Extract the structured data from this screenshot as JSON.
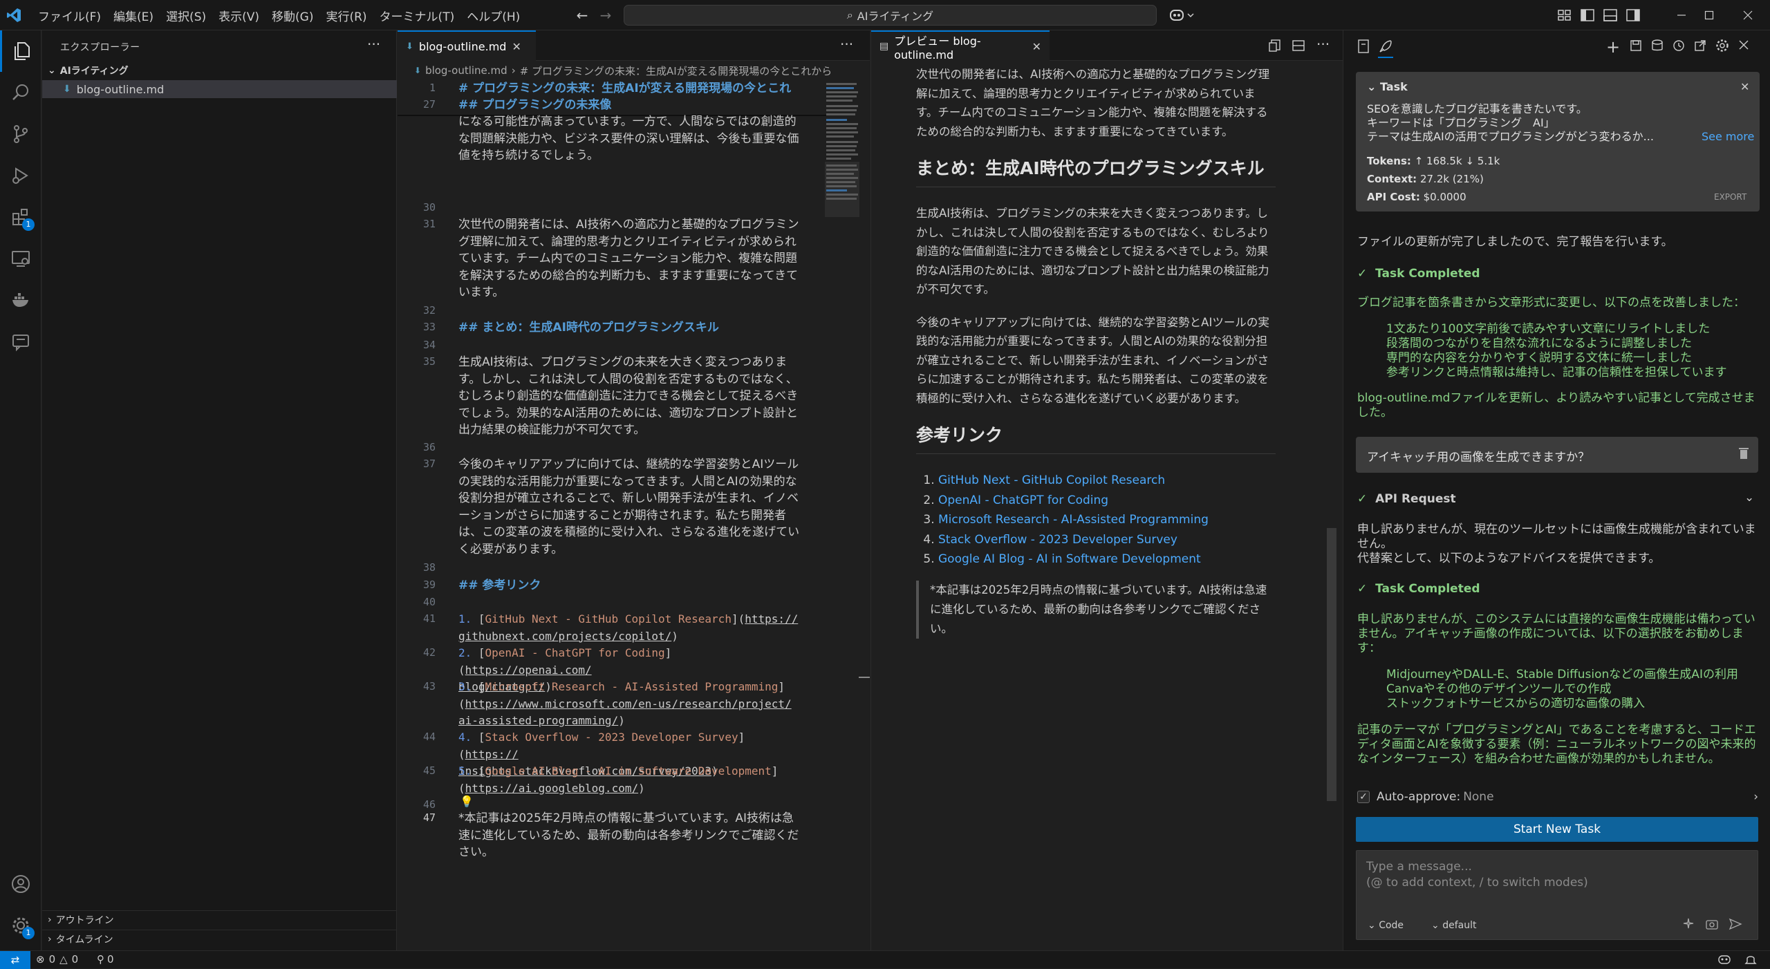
{
  "titlebar": {
    "menus": [
      "ファイル(F)",
      "編集(E)",
      "選択(S)",
      "表示(V)",
      "移動(G)",
      "実行(R)",
      "ターミナル(T)",
      "ヘルプ(H)"
    ],
    "search_text": "AIライティング"
  },
  "activity": {
    "extensions_badge": "1",
    "settings_badge": "1"
  },
  "sidebar": {
    "title": "エクスプローラー",
    "folder": "AIライティング",
    "file": "blog-outline.md",
    "outline": "アウトライン",
    "timeline": "タイムライン"
  },
  "editor": {
    "tab": "blog-outline.md",
    "breadcrumb_file": "blog-outline.md",
    "breadcrumb_symbol": "# プログラミングの未来：生成AIが変える開発現場の今とこれから",
    "sticky": [
      {
        "ln": "1",
        "text": "# プログラミングの未来：生成AIが変える開発現場の今とこれ"
      },
      {
        "ln": "27",
        "text": "## プログラミングの未来像"
      }
    ],
    "l29": "になる可能性が高まっています。一方で、人間ならではの創造的な問題解決能力や、ビジネス要件の深い理解は、今後も重要な価値を持ち続けるでしょう。",
    "l31": "次世代の開発者には、AI技術への適応力と基礎的なプログラミング理解に加えて、論理的思考力とクリエイティビティが求められています。チーム内でのコミュニケーション能力や、複雑な問題を解決するための総合的な判断力も、ますます重要になってきています。",
    "l33": "## まとめ：生成AI時代のプログラミングスキル",
    "l35": "生成AI技術は、プログラミングの未来を大きく変えつつあります。しかし、これは決して人間の役割を否定するものではなく、むしろより創造的な価値創造に注力できる機会として捉えるべきでしょう。効果的なAI活用のためには、適切なプロンプト設計と出力結果の検証能力が不可欠です。",
    "l37": "今後のキャリアアップに向けては、継続的な学習姿勢とAIツールの実践的な活用能力が重要になってきます。人間とAIの効果的な役割分担が確立されることで、新しい開発手法が生まれ、イノベーションがさらに加速することが期待されます。私たち開発者は、この変革の波を積極的に受け入れ、さらなる進化を遂げていく必要があります。",
    "l39": "## 参考リンク",
    "links": [
      {
        "ln": "41",
        "n": "1.",
        "text": "GitHub Next - GitHub Copilot Research",
        "url1": "https://",
        "url2": "githubnext.com/projects/copilot/"
      },
      {
        "ln": "42",
        "n": "2.",
        "text": "OpenAI - ChatGPT for Coding",
        "url1": "https://openai.com/",
        "url2": "blog/chatgpt/"
      },
      {
        "ln": "43",
        "n": "3.",
        "text": "Microsoft Research - AI-Assisted Programming",
        "url1": "https://www.microsoft.com/en-us/research/project/",
        "url2": "ai-assisted-programming/"
      },
      {
        "ln": "44",
        "n": "4.",
        "text": "Stack Overflow - 2023 Developer Survey",
        "url1": "https://",
        "url2": "insights.stackoverflow.com/survey/2023"
      },
      {
        "ln": "45",
        "n": "5.",
        "text": "Google AI Blog - AI in Software Development",
        "url1": "",
        "url2": "https://ai.googleblog.com/"
      }
    ],
    "l47": "*本記事は2025年2月時点の情報に基づいています。AI技術は急速に進化しているため、最新の動向は各参考リンクでご確認ください。"
  },
  "preview": {
    "tab": "プレビュー blog-outline.md",
    "p1": "次世代の開発者には、AI技術への適応力と基礎的なプログラミング理解に加えて、論理的思考力とクリエイティビティが求められています。チーム内でのコミュニケーション能力や、複雑な問題を解決するための総合的な判断力も、ますます重要になってきています。",
    "h1": "まとめ：生成AI時代のプログラミングスキル",
    "p2": "生成AI技術は、プログラミングの未来を大きく変えつつあります。しかし、これは決して人間の役割を否定するものではなく、むしろより創造的な価値創造に注力できる機会として捉えるべきでしょう。効果的なAI活用のためには、適切なプロンプト設計と出力結果の検証能力が不可欠です。",
    "p3": "今後のキャリアアップに向けては、継続的な学習姿勢とAIツールの実践的な活用能力が重要になってきます。人間とAIの効果的な役割分担が確立されることで、新しい開発手法が生まれ、イノベーションがさらに加速することが期待されます。私たち開発者は、この変革の波を積極的に受け入れ、さらなる進化を遂げていく必要があります。",
    "h2": "参考リンク",
    "links": [
      "GitHub Next - GitHub Copilot Research",
      "OpenAI - ChatGPT for Coding",
      "Microsoft Research - AI-Assisted Programming",
      "Stack Overflow - 2023 Developer Survey",
      "Google AI Blog - AI in Software Development"
    ],
    "note": "*本記事は2025年2月時点の情報に基づいています。AI技術は急速に進化しているため、最新の動向は各参考リンクでご確認ください。"
  },
  "cline": {
    "task_title": "Task",
    "task_line1": "SEOを意識したブログ記事を書きたいです。",
    "task_line2": "キーワードは「プログラミング　AI」",
    "task_line3": "テーマは生成AIの活用でプログラミングがどう変わるか...",
    "see_more": "See more",
    "tokens_label": "Tokens:",
    "tokens_up": "↑ 168.5k",
    "tokens_down": "↓ 5.1k",
    "context_label": "Context:",
    "context_value": "27.2k (21%)",
    "cost_label": "API Cost:",
    "cost_value": "$0.0000",
    "export": "EXPORT",
    "msg1": "ファイルの更新が完了しましたので、完了報告を行います。",
    "completed1": "Task Completed",
    "c1_intro": "ブログ記事を箇条書きから文章形式に変更し、以下の点を改善しました：",
    "c1_items": [
      "1文あたり100文字前後で読みやすい文章にリライトしました",
      "段落間のつながりを自然な流れになるように調整しました",
      "専門的な内容を分かりやすく説明する文体に統一しました",
      "参考リンクと時点情報は維持し、記事の信頼性を担保しています"
    ],
    "c1_outro": "blog-outline.mdファイルを更新し、より読みやすい記事として完成させました。",
    "user_question": "アイキャッチ用の画像を生成できますか？",
    "api_request": "API Request",
    "api_text1": "申し訳ありませんが、現在のツールセットには画像生成機能が含まれていません。",
    "api_text2": "代替案として、以下のようなアドバイスを提供できます。",
    "completed2": "Task Completed",
    "c2_intro": "申し訳ありませんが、このシステムには直接的な画像生成機能は備わっていません。アイキャッチ画像の作成については、以下の選択肢をお勧めします：",
    "c2_items": [
      "MidjourneyやDALL-E、Stable Diffusionなどの画像生成AIの利用",
      "Canvaやその他のデザインツールでの作成",
      "ストックフォトサービスからの適切な画像の購入"
    ],
    "c2_outro": "記事のテーマが「プログラミングとAI」であることを考慮すると、コードエディタ画面とAIを象徴する要素（例：ニューラルネットワークの図や未来的なインターフェース）を組み合わせた画像が効果的かもしれません。",
    "auto_approve_label": "Auto-approve:",
    "auto_approve_value": "None",
    "start_new_task": "Start New Task",
    "input_placeholder1": "Type a message...",
    "input_placeholder2": "(@ to add context, / to switch modes)",
    "mode": "Code",
    "model": "default"
  },
  "status": {
    "errors": "0",
    "warnings": "0",
    "ports": "0"
  }
}
